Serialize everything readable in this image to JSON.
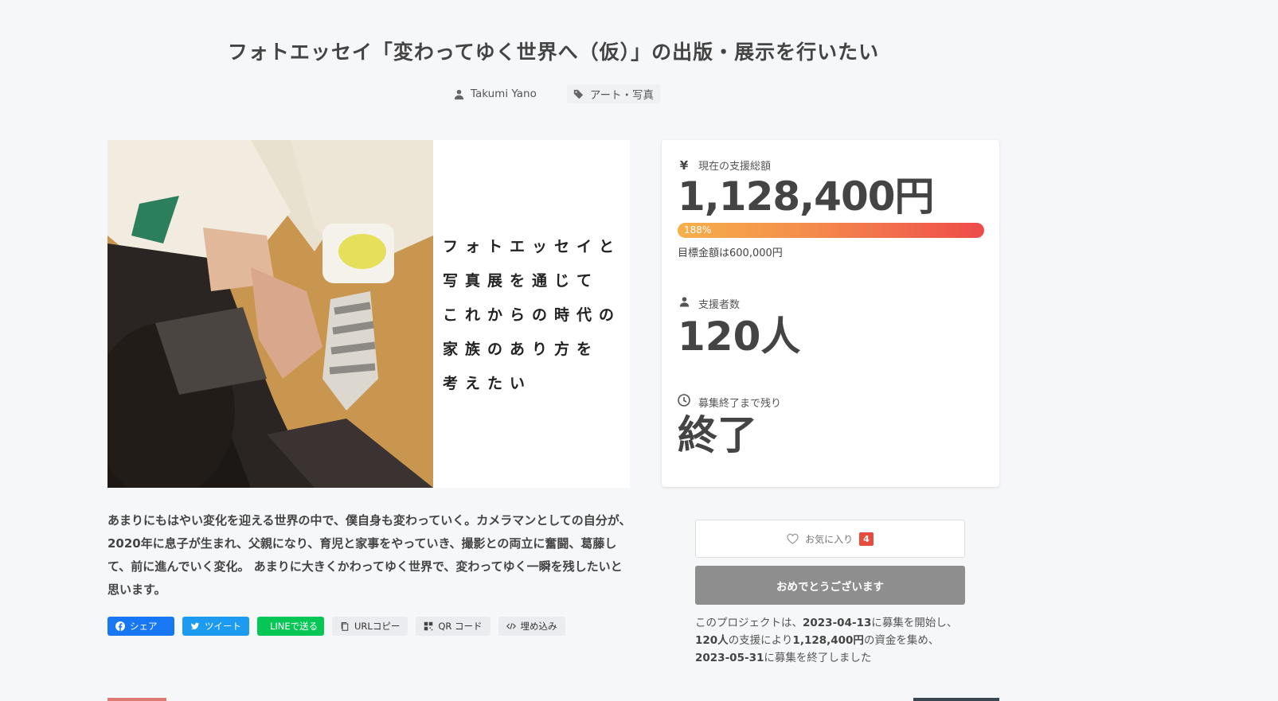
{
  "project": {
    "title": "フォトエッセイ「変わってゆく世界へ（仮）」の出版・展示を行いたい",
    "author": "Takumi Yano",
    "category": "アート・写真"
  },
  "hero": {
    "lines": [
      "フォトエッセイと",
      "写真展を通じて",
      "これからの時代の",
      "家族のあり方を",
      "考えたい"
    ]
  },
  "stats": {
    "amount_label": "現在の支援総額",
    "amount": "1,128,400円",
    "progress_text": "188%",
    "progress_fraction": 1.88,
    "goal": "目標金額は600,000円",
    "supporters_label": "支援者数",
    "supporters": "120人",
    "remaining_label": "募集終了まで残り",
    "remaining": "終了"
  },
  "description": "あまりにもはやい変化を迎える世界の中で、僕自身も変わっていく。カメラマンとしての自分が、2020年に息子が生まれ、父親になり、育児と家事をやっていき、撮影との両立に奮闘、葛藤して、前に進んでいく変化。 あまりに大きくかわってゆく世界で、変わってゆく一瞬を残したいと思います。",
  "share": {
    "facebook": "シェア",
    "twitter": "ツイート",
    "line": "LINEで送る",
    "url_copy": "URLコピー",
    "qr": "QR コード",
    "embed": "埋め込み"
  },
  "actions": {
    "favorite_label": "お気に入り",
    "favorite_count": "4",
    "congrats": "おめでとうございます"
  },
  "summary": {
    "p1": "このプロジェクトは、",
    "start": "2023-04-13",
    "p2": "に募集を開始し、",
    "count": "120人",
    "p3": "の支援により",
    "amount": "1,128,400円",
    "p4": "の資金を集め、",
    "end": "2023-05-31",
    "p5": "に募集を終了しました"
  },
  "colors": {
    "facebook": "#1877f2",
    "twitter": "#1d9bf0",
    "line": "#06c755",
    "badge": "#e74c3c",
    "progress_start": "#f6b04a",
    "progress_end": "#ee4b4b"
  }
}
